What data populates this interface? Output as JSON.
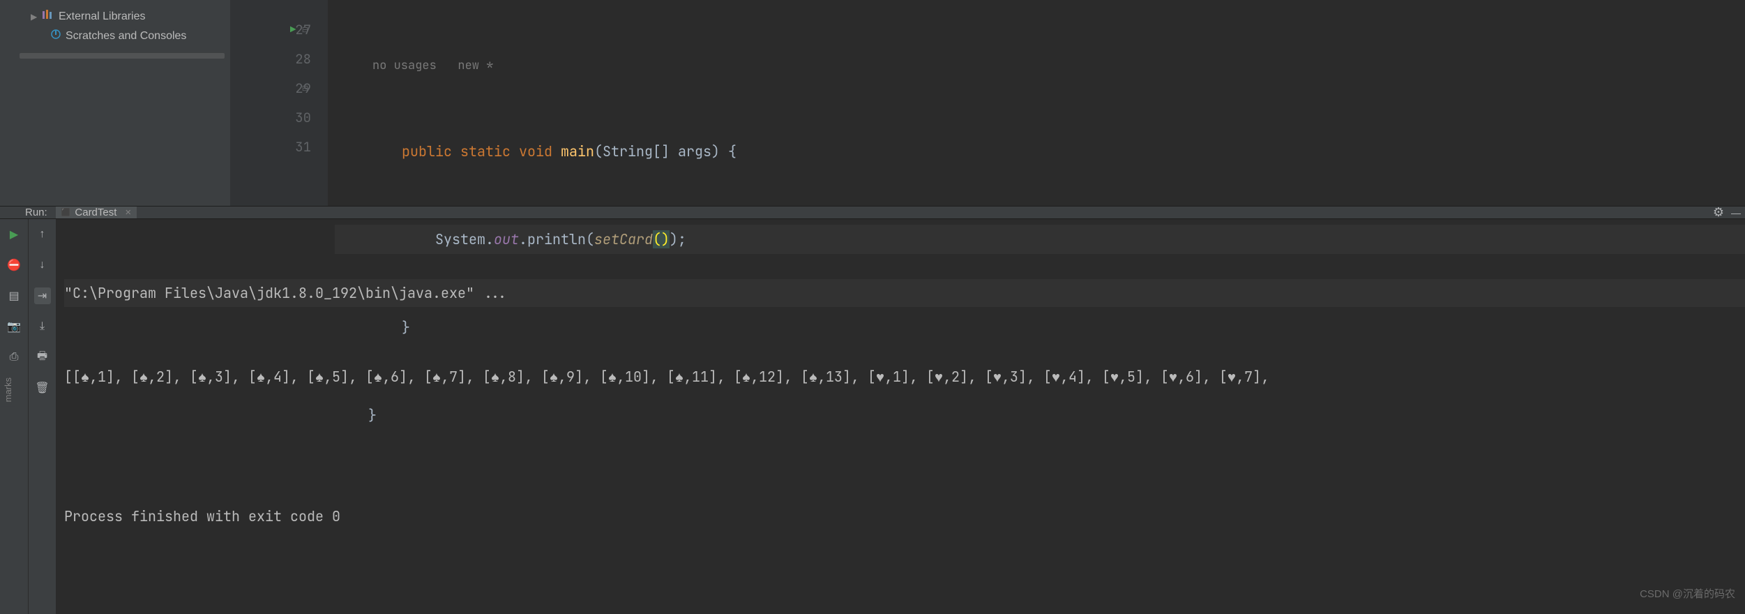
{
  "sidebar": {
    "items": [
      {
        "label": "External Libraries",
        "icon": "library"
      },
      {
        "label": "Scratches and Consoles",
        "icon": "scratch"
      }
    ]
  },
  "editor": {
    "hint": "no usages   new *",
    "lines": [
      {
        "num": 27,
        "hasRun": true,
        "fold": "open",
        "tokens": [
          {
            "cls": "kw",
            "t": "public "
          },
          {
            "cls": "kw",
            "t": "static "
          },
          {
            "cls": "type",
            "t": "void "
          },
          {
            "cls": "method",
            "t": "main"
          },
          {
            "cls": "paren",
            "t": "("
          },
          {
            "cls": "ident",
            "t": "String[] args"
          },
          {
            "cls": "paren",
            "t": ") "
          },
          {
            "cls": "brace",
            "t": "{"
          }
        ]
      },
      {
        "num": 28,
        "caret": true,
        "tokens": [
          {
            "cls": "ident",
            "t": "    System."
          },
          {
            "cls": "field-italic",
            "t": "out"
          },
          {
            "cls": "ident",
            "t": ".println("
          },
          {
            "cls": "call-italic",
            "t": "setCard"
          },
          {
            "cls": "paren-hl",
            "t": "("
          },
          {
            "cls": "paren-hl",
            "t": ")"
          },
          {
            "cls": "ident",
            "t": ");"
          }
        ]
      },
      {
        "num": 29,
        "fold": "close",
        "tokens": [
          {
            "cls": "brace",
            "t": "}"
          }
        ]
      },
      {
        "num": 30,
        "tokens": [
          {
            "cls": "brace",
            "t": "}"
          }
        ],
        "dedent": true
      },
      {
        "num": 31,
        "tokens": []
      }
    ]
  },
  "run": {
    "panel_label": "Run:",
    "tab_label": "CardTest",
    "console_lines": [
      "\"C:\\Program Files\\Java\\jdk1.8.0_192\\bin\\java.exe\" ...",
      "[[♠,1], [♠,2], [♠,3], [♠,4], [♠,5], [♠,6], [♠,7], [♠,8], [♠,9], [♠,10], [♠,11], [♠,12], [♠,13], [♥,1], [♥,2], [♥,3], [♥,4], [♥,5], [♥,6], [♥,7],",
      "",
      "Process finished with exit code 0"
    ]
  },
  "vert_label": "marks",
  "watermark": "CSDN @沉着的码农"
}
